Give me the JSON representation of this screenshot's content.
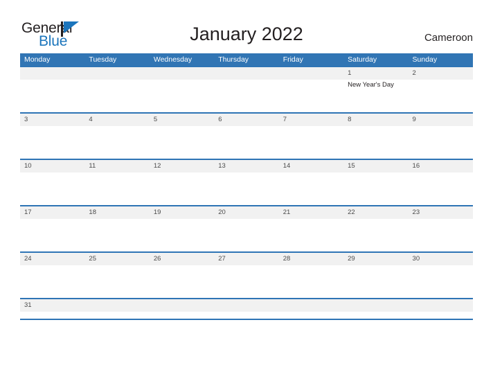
{
  "brand": {
    "name_part1": "General",
    "name_part2": "Blue",
    "logo_icon": "flag-icon",
    "color_dark": "#231f20",
    "color_blue": "#1b75bc"
  },
  "header": {
    "title": "January 2022",
    "country": "Cameroon"
  },
  "theme": {
    "header_blue": "#3175b4",
    "rule_blue": "#2e74b5",
    "band_gray": "#f1f1f1",
    "text_dark": "#231f20",
    "day_number_gray": "#4a4a4a"
  },
  "calendar": {
    "weekday_headers": [
      "Monday",
      "Tuesday",
      "Wednesday",
      "Thursday",
      "Friday",
      "Saturday",
      "Sunday"
    ],
    "weeks": [
      [
        {
          "num": "",
          "event": ""
        },
        {
          "num": "",
          "event": ""
        },
        {
          "num": "",
          "event": ""
        },
        {
          "num": "",
          "event": ""
        },
        {
          "num": "",
          "event": ""
        },
        {
          "num": "1",
          "event": "New Year's Day"
        },
        {
          "num": "2",
          "event": ""
        }
      ],
      [
        {
          "num": "3",
          "event": ""
        },
        {
          "num": "4",
          "event": ""
        },
        {
          "num": "5",
          "event": ""
        },
        {
          "num": "6",
          "event": ""
        },
        {
          "num": "7",
          "event": ""
        },
        {
          "num": "8",
          "event": ""
        },
        {
          "num": "9",
          "event": ""
        }
      ],
      [
        {
          "num": "10",
          "event": ""
        },
        {
          "num": "11",
          "event": ""
        },
        {
          "num": "12",
          "event": ""
        },
        {
          "num": "13",
          "event": ""
        },
        {
          "num": "14",
          "event": ""
        },
        {
          "num": "15",
          "event": ""
        },
        {
          "num": "16",
          "event": ""
        }
      ],
      [
        {
          "num": "17",
          "event": ""
        },
        {
          "num": "18",
          "event": ""
        },
        {
          "num": "19",
          "event": ""
        },
        {
          "num": "20",
          "event": ""
        },
        {
          "num": "21",
          "event": ""
        },
        {
          "num": "22",
          "event": ""
        },
        {
          "num": "23",
          "event": ""
        }
      ],
      [
        {
          "num": "24",
          "event": ""
        },
        {
          "num": "25",
          "event": ""
        },
        {
          "num": "26",
          "event": ""
        },
        {
          "num": "27",
          "event": ""
        },
        {
          "num": "28",
          "event": ""
        },
        {
          "num": "29",
          "event": ""
        },
        {
          "num": "30",
          "event": ""
        }
      ],
      [
        {
          "num": "31",
          "event": ""
        },
        {
          "num": "",
          "event": ""
        },
        {
          "num": "",
          "event": ""
        },
        {
          "num": "",
          "event": ""
        },
        {
          "num": "",
          "event": ""
        },
        {
          "num": "",
          "event": ""
        },
        {
          "num": "",
          "event": ""
        }
      ]
    ]
  }
}
